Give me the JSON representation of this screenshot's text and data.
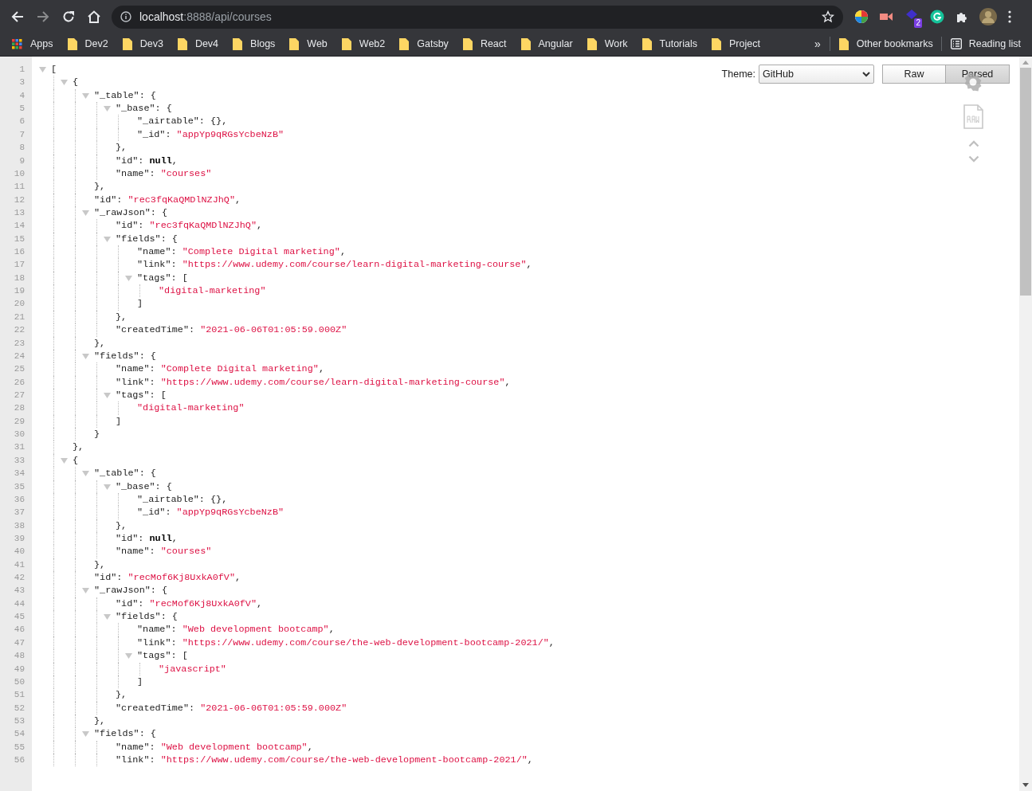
{
  "browser": {
    "url": {
      "host": "localhost",
      "path": ":8888/api/courses"
    },
    "extension_badge": "2",
    "bookmarks": [
      {
        "label": "Apps",
        "kind": "apps"
      },
      {
        "label": "Dev2",
        "kind": "folder"
      },
      {
        "label": "Dev3",
        "kind": "folder"
      },
      {
        "label": "Dev4",
        "kind": "folder"
      },
      {
        "label": "Blogs",
        "kind": "folder"
      },
      {
        "label": "Web",
        "kind": "folder"
      },
      {
        "label": "Web2",
        "kind": "folder"
      },
      {
        "label": "Gatsby",
        "kind": "folder"
      },
      {
        "label": "React",
        "kind": "folder"
      },
      {
        "label": "Angular",
        "kind": "folder"
      },
      {
        "label": "Work",
        "kind": "folder"
      },
      {
        "label": "Tutorials",
        "kind": "folder"
      },
      {
        "label": "Project",
        "kind": "folder"
      }
    ],
    "overflow": "»",
    "other_bookmarks": "Other bookmarks",
    "reading_list": "Reading list"
  },
  "viewer": {
    "theme_label": "Theme:",
    "theme": "GitHub",
    "modes": [
      {
        "label": "Raw",
        "selected": false
      },
      {
        "label": "Parsed",
        "selected": true
      }
    ],
    "lines": [
      {
        "n": "1",
        "value": "[",
        "kind": "punct",
        "expanded": true,
        "children": [
          {
            "n": "3",
            "value": "{",
            "kind": "punct",
            "expanded": true,
            "children": [
              {
                "n": "4",
                "key": "\"_table\":",
                "value": "{",
                "kind": "punct",
                "expanded": true,
                "children": [
                  {
                    "n": "5",
                    "key": "\"_base\":",
                    "value": "{",
                    "kind": "punct",
                    "expanded": true,
                    "children": [
                      {
                        "n": "6",
                        "key": "\"_airtable\":",
                        "value": "{},",
                        "kind": "punct"
                      },
                      {
                        "n": "7",
                        "key": "\"_id\":",
                        "value": "\"appYp9qRGsYcbeNzB\"",
                        "kind": "string"
                      }
                    ],
                    "end": {
                      "n": "8",
                      "value": "},",
                      "kind": "punct"
                    }
                  },
                  {
                    "n": "9",
                    "key": "\"id\":",
                    "value": "null",
                    "kind": "null",
                    "tail": ","
                  },
                  {
                    "n": "10",
                    "key": "\"name\":",
                    "value": "\"courses\"",
                    "kind": "string"
                  }
                ],
                "end": {
                  "n": "11",
                  "value": "},",
                  "kind": "punct"
                }
              },
              {
                "n": "12",
                "key": "\"id\":",
                "value": "\"rec3fqKaQMDlNZJhQ\"",
                "kind": "string",
                "tail": ","
              },
              {
                "n": "13",
                "key": "\"_rawJson\":",
                "value": "{",
                "kind": "punct",
                "expanded": true,
                "children": [
                  {
                    "n": "14",
                    "key": "\"id\":",
                    "value": "\"rec3fqKaQMDlNZJhQ\"",
                    "kind": "string",
                    "tail": ","
                  },
                  {
                    "n": "15",
                    "key": "\"fields\":",
                    "value": "{",
                    "kind": "punct",
                    "expanded": true,
                    "children": [
                      {
                        "n": "16",
                        "key": "\"name\":",
                        "value": "\"Complete Digital marketing\"",
                        "kind": "string",
                        "tail": ","
                      },
                      {
                        "n": "17",
                        "key": "\"link\":",
                        "value": "\"https://www.udemy.com/course/learn-digital-marketing-course\"",
                        "kind": "string",
                        "tail": ","
                      },
                      {
                        "n": "18",
                        "key": "\"tags\":",
                        "value": "[",
                        "kind": "punct",
                        "expanded": true,
                        "children": [
                          {
                            "n": "19",
                            "value": "\"digital-marketing\"",
                            "kind": "string"
                          }
                        ],
                        "end": {
                          "n": "20",
                          "value": "]",
                          "kind": "punct"
                        }
                      }
                    ],
                    "end": {
                      "n": "21",
                      "value": "},",
                      "kind": "punct"
                    }
                  },
                  {
                    "n": "22",
                    "key": "\"createdTime\":",
                    "value": "\"2021-06-06T01:05:59.000Z\"",
                    "kind": "string"
                  }
                ],
                "end": {
                  "n": "23",
                  "value": "},",
                  "kind": "punct"
                }
              },
              {
                "n": "24",
                "key": "\"fields\":",
                "value": "{",
                "kind": "punct",
                "expanded": true,
                "children": [
                  {
                    "n": "25",
                    "key": "\"name\":",
                    "value": "\"Complete Digital marketing\"",
                    "kind": "string",
                    "tail": ","
                  },
                  {
                    "n": "26",
                    "key": "\"link\":",
                    "value": "\"https://www.udemy.com/course/learn-digital-marketing-course\"",
                    "kind": "string",
                    "tail": ","
                  },
                  {
                    "n": "27",
                    "key": "\"tags\":",
                    "value": "[",
                    "kind": "punct",
                    "expanded": true,
                    "children": [
                      {
                        "n": "28",
                        "value": "\"digital-marketing\"",
                        "kind": "string"
                      }
                    ],
                    "end": {
                      "n": "29",
                      "value": "]",
                      "kind": "punct"
                    }
                  }
                ],
                "end": {
                  "n": "30",
                  "value": "}",
                  "kind": "punct"
                }
              }
            ],
            "end": {
              "n": "31",
              "value": "},",
              "kind": "punct"
            }
          },
          {
            "n": "33",
            "value": "{",
            "kind": "punct",
            "expanded": true,
            "children": [
              {
                "n": "34",
                "key": "\"_table\":",
                "value": "{",
                "kind": "punct",
                "expanded": true,
                "children": [
                  {
                    "n": "35",
                    "key": "\"_base\":",
                    "value": "{",
                    "kind": "punct",
                    "expanded": true,
                    "children": [
                      {
                        "n": "36",
                        "key": "\"_airtable\":",
                        "value": "{},",
                        "kind": "punct"
                      },
                      {
                        "n": "37",
                        "key": "\"_id\":",
                        "value": "\"appYp9qRGsYcbeNzB\"",
                        "kind": "string"
                      }
                    ],
                    "end": {
                      "n": "38",
                      "value": "},",
                      "kind": "punct"
                    }
                  },
                  {
                    "n": "39",
                    "key": "\"id\":",
                    "value": "null",
                    "kind": "null",
                    "tail": ","
                  },
                  {
                    "n": "40",
                    "key": "\"name\":",
                    "value": "\"courses\"",
                    "kind": "string"
                  }
                ],
                "end": {
                  "n": "41",
                  "value": "},",
                  "kind": "punct"
                }
              },
              {
                "n": "42",
                "key": "\"id\":",
                "value": "\"recMof6Kj8UxkA0fV\"",
                "kind": "string",
                "tail": ","
              },
              {
                "n": "43",
                "key": "\"_rawJson\":",
                "value": "{",
                "kind": "punct",
                "expanded": true,
                "children": [
                  {
                    "n": "44",
                    "key": "\"id\":",
                    "value": "\"recMof6Kj8UxkA0fV\"",
                    "kind": "string",
                    "tail": ","
                  },
                  {
                    "n": "45",
                    "key": "\"fields\":",
                    "value": "{",
                    "kind": "punct",
                    "expanded": true,
                    "children": [
                      {
                        "n": "46",
                        "key": "\"name\":",
                        "value": "\"Web development bootcamp\"",
                        "kind": "string",
                        "tail": ","
                      },
                      {
                        "n": "47",
                        "key": "\"link\":",
                        "value": "\"https://www.udemy.com/course/the-web-development-bootcamp-2021/\"",
                        "kind": "string",
                        "tail": ","
                      },
                      {
                        "n": "48",
                        "key": "\"tags\":",
                        "value": "[",
                        "kind": "punct",
                        "expanded": true,
                        "children": [
                          {
                            "n": "49",
                            "value": "\"javascript\"",
                            "kind": "string"
                          }
                        ],
                        "end": {
                          "n": "50",
                          "value": "]",
                          "kind": "punct"
                        }
                      }
                    ],
                    "end": {
                      "n": "51",
                      "value": "},",
                      "kind": "punct"
                    }
                  },
                  {
                    "n": "52",
                    "key": "\"createdTime\":",
                    "value": "\"2021-06-06T01:05:59.000Z\"",
                    "kind": "string"
                  }
                ],
                "end": {
                  "n": "53",
                  "value": "},",
                  "kind": "punct"
                }
              },
              {
                "n": "54",
                "key": "\"fields\":",
                "value": "{",
                "kind": "punct",
                "expanded": true,
                "children": [
                  {
                    "n": "55",
                    "key": "\"name\":",
                    "value": "\"Web development bootcamp\"",
                    "kind": "string",
                    "tail": ","
                  },
                  {
                    "n": "56",
                    "key": "\"link\":",
                    "value": "\"https://www.udemy.com/course/the-web-development-bootcamp-2021/\"",
                    "kind": "string",
                    "tail": ","
                  }
                ]
              }
            ]
          }
        ]
      }
    ]
  }
}
